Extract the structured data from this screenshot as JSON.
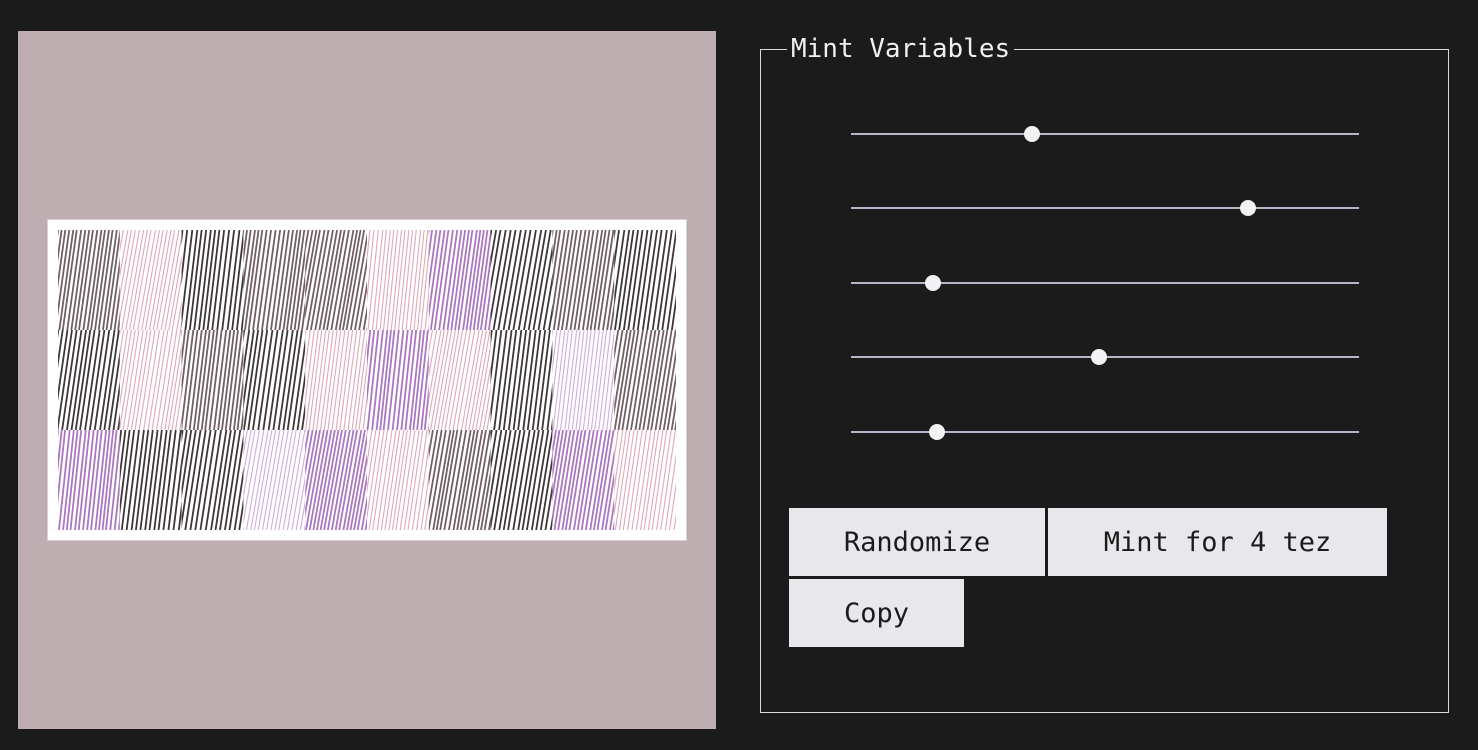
{
  "panel": {
    "title": "Mint Variables"
  },
  "sliders": [
    {
      "value": 0.356
    },
    {
      "value": 0.781
    },
    {
      "value": 0.161
    },
    {
      "value": 0.489
    },
    {
      "value": 0.169
    }
  ],
  "buttons": {
    "randomize": "Randomize",
    "mint": "Mint for 4 tez",
    "copy": "Copy"
  },
  "artwork": {
    "background": "#beaeb1",
    "rows": 3,
    "cols": 10,
    "palette": {
      "dark": "#1c1416",
      "brown": "#5a4448",
      "pink": "#d99aaa",
      "purple": "#9d5fb7",
      "lavender": "#c79fd6"
    },
    "tiles": [
      [
        "brown",
        "pink",
        "dark",
        "brown",
        "brown",
        "pink",
        "purple",
        "dark",
        "brown",
        "dark"
      ],
      [
        "dark",
        "pink",
        "brown",
        "dark",
        "pink",
        "purple",
        "pink",
        "dark",
        "lavender",
        "brown"
      ],
      [
        "purple",
        "dark",
        "dark",
        "lavender",
        "purple",
        "pink",
        "brown",
        "dark",
        "purple",
        "pink"
      ]
    ]
  }
}
